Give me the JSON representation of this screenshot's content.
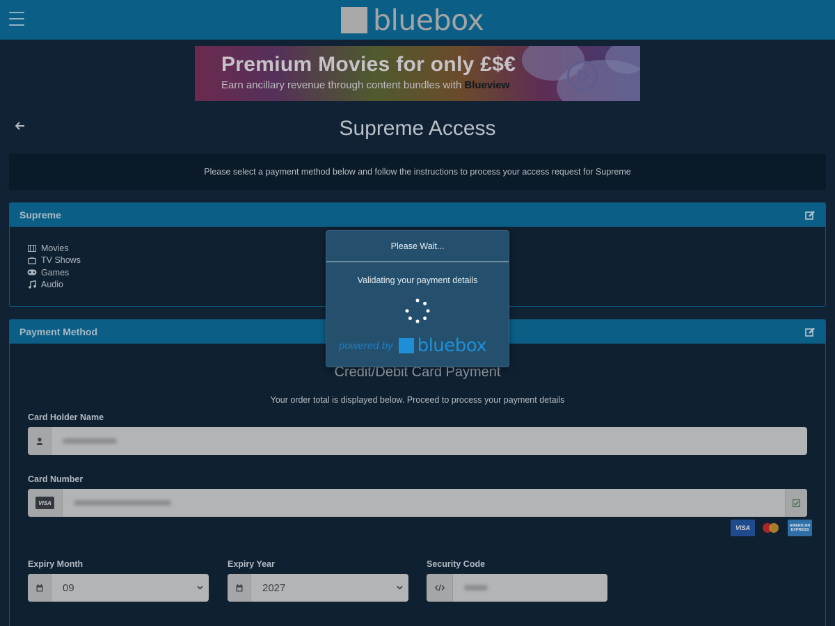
{
  "header": {
    "logo_text": "bluebox",
    "menu_icon": "hamburger-menu-icon"
  },
  "banner": {
    "title": "Premium Movies for only £$€",
    "subtitle_prefix": "Earn ancillary revenue through content bundles with ",
    "subtitle_brand": "Blueview"
  },
  "page": {
    "title": "Supreme Access",
    "back_icon": "arrow-left-icon",
    "info": "Please select a payment method below and follow the instructions to process your access request for Supreme"
  },
  "package_panel": {
    "title": "Supreme",
    "edit_icon": "edit-icon",
    "features": [
      {
        "label": "Movies",
        "icon": "film-icon"
      },
      {
        "label": "TV Shows",
        "icon": "tv-icon"
      },
      {
        "label": "Games",
        "icon": "gamepad-icon"
      },
      {
        "label": "Audio",
        "icon": "music-icon"
      }
    ]
  },
  "payment_panel": {
    "title": "Payment Method",
    "edit_icon": "edit-icon",
    "method_title": "Credit/Debit Card Payment",
    "method_subtitle": "Your order total is displayed below. Proceed to process your payment details",
    "card_holder": {
      "label": "Card Holder Name",
      "icon": "user-icon"
    },
    "card_number": {
      "label": "Card Number",
      "badge": "VISA",
      "valid_icon": "check-square-icon"
    },
    "accepted_cards": [
      "VISA",
      "MASTERCARD",
      "AMERICAN EXPRESS"
    ],
    "expiry_month": {
      "label": "Expiry Month",
      "value": "09",
      "icon": "calendar-icon"
    },
    "expiry_year": {
      "label": "Expiry Year",
      "value": "2027",
      "icon": "calendar-icon"
    },
    "security_code": {
      "label": "Security Code",
      "icon": "code-icon"
    }
  },
  "modal": {
    "title": "Please Wait...",
    "message": "Validating your payment details",
    "powered_by": "powered by",
    "brand": "bluebox"
  },
  "colors": {
    "background": "#102233",
    "topbar": "#0b5f86",
    "modal": "#24506e",
    "brand_blue": "#1e8fd6"
  }
}
